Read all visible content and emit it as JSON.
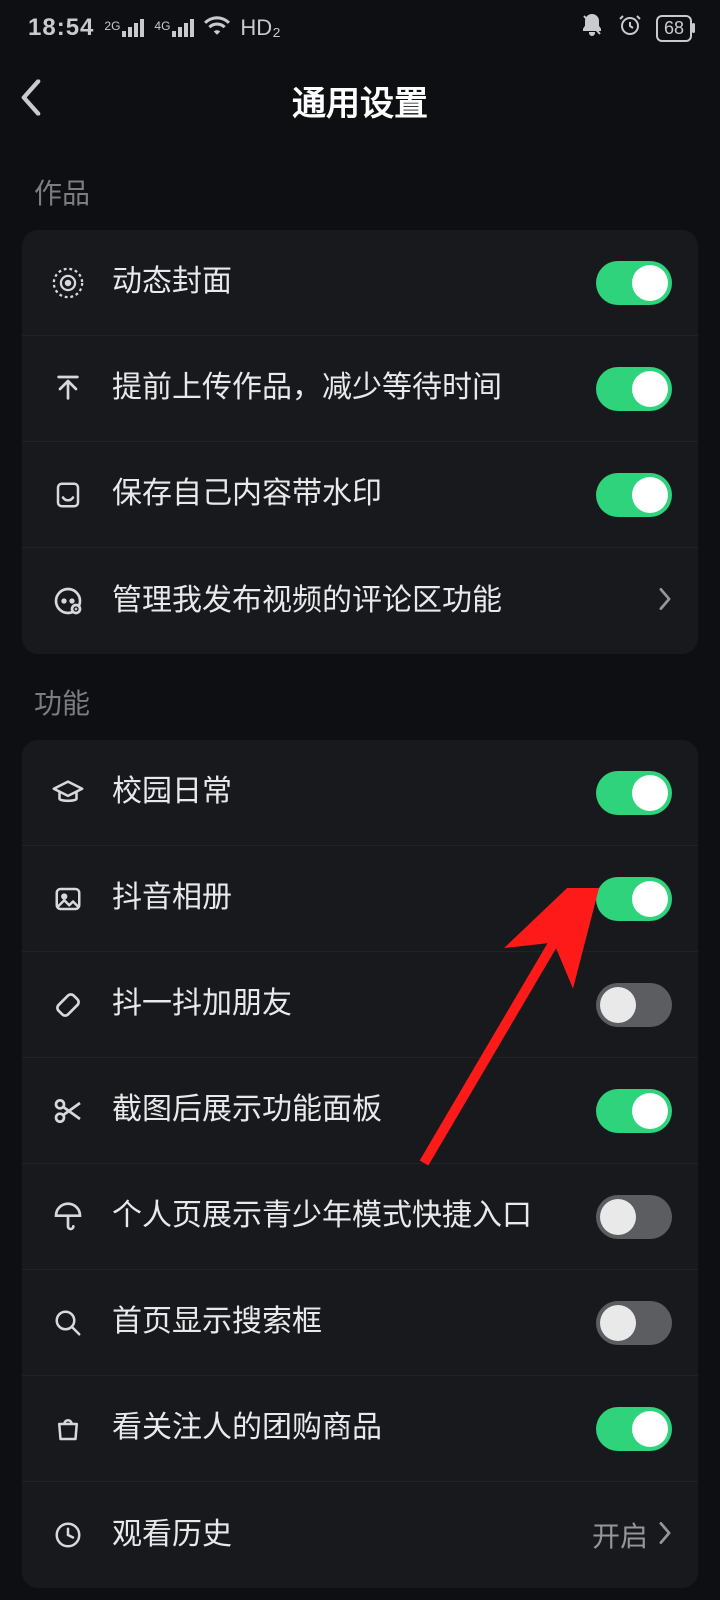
{
  "status": {
    "time": "18:54",
    "net1_label": "2G",
    "net2_label": "4G",
    "hd_label": "HD₂",
    "battery": "68"
  },
  "header": {
    "title": "通用设置"
  },
  "sections": [
    {
      "title": "作品",
      "rows": [
        {
          "icon": "target-icon",
          "label": "动态封面",
          "type": "toggle",
          "on": true
        },
        {
          "icon": "upload-icon",
          "label": "提前上传作品，减少等待时间",
          "type": "toggle",
          "on": true
        },
        {
          "icon": "save-icon",
          "label": "保存自己内容带水印",
          "type": "toggle",
          "on": true
        },
        {
          "icon": "comment-icon",
          "label": "管理我发布视频的评论区功能",
          "type": "link"
        }
      ]
    },
    {
      "title": "功能",
      "rows": [
        {
          "icon": "graduation-icon",
          "label": "校园日常",
          "type": "toggle",
          "on": true
        },
        {
          "icon": "photo-icon",
          "label": "抖音相册",
          "type": "toggle",
          "on": true
        },
        {
          "icon": "shake-icon",
          "label": "抖一抖加朋友",
          "type": "toggle",
          "on": false
        },
        {
          "icon": "scissors-icon",
          "label": "截图后展示功能面板",
          "type": "toggle",
          "on": true
        },
        {
          "icon": "umbrella-icon",
          "label": "个人页展示青少年模式快捷入口",
          "type": "toggle",
          "on": false
        },
        {
          "icon": "search-icon",
          "label": "首页显示搜索框",
          "type": "toggle",
          "on": false
        },
        {
          "icon": "bag-icon",
          "label": "看关注人的团购商品",
          "type": "toggle",
          "on": true
        },
        {
          "icon": "clock-icon",
          "label": "观看历史",
          "type": "link",
          "value": "开启"
        }
      ]
    }
  ],
  "annotation": {
    "arrow_color": "#ff1a1a"
  }
}
